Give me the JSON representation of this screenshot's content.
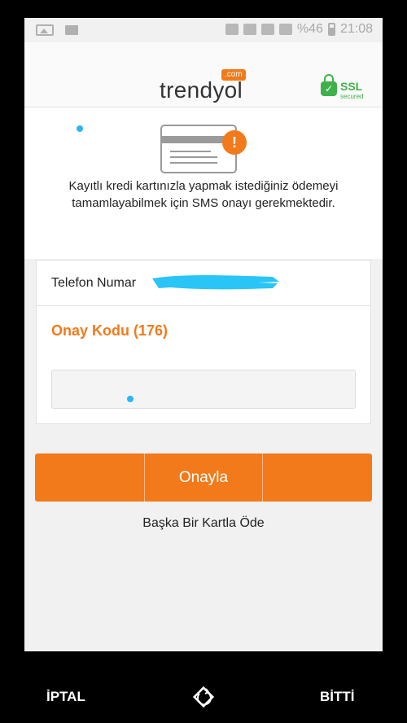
{
  "status_bar": {
    "battery": "%46",
    "time": "21:08"
  },
  "header": {
    "logo": "trendyol",
    "logo_suffix": ".com",
    "ssl_label": "SSL",
    "ssl_sub": "secured"
  },
  "info": {
    "message_line1": "Kayıtlı kredi kartınızla yapmak istediğiniz ödemeyi",
    "message_line2": "tamamlayabilmek için SMS onayı gerekmektedir."
  },
  "form": {
    "phone_label": "Telefon Numar",
    "code_label": "Onay Kodu (176)",
    "code_value": ""
  },
  "actions": {
    "approve_label": "Onayla",
    "other_card_label": "Başka Bir Kartla Öde"
  },
  "bottom_bar": {
    "cancel_label": "İPTAL",
    "done_label": "BİTTİ"
  },
  "colors": {
    "accent": "#f27a1a",
    "ssl_green": "#3fb14a",
    "redaction": "#29c5f6"
  }
}
